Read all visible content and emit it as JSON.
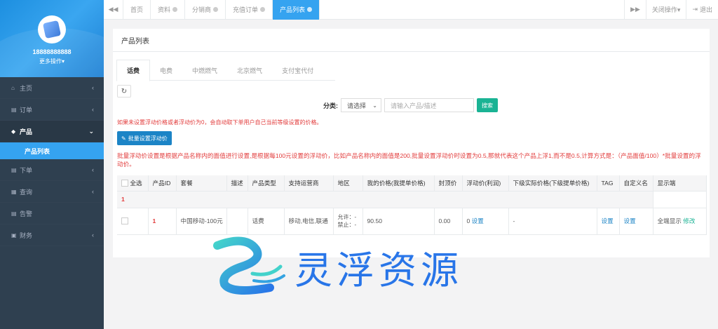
{
  "sidebar": {
    "phone": "18888888888",
    "more": "更多操作▾",
    "items": [
      {
        "label": "主页",
        "icon": "home-icon",
        "glyph": "⌂"
      },
      {
        "label": "订单",
        "icon": "file-icon",
        "glyph": "▤"
      },
      {
        "label": "产品",
        "icon": "cube-icon",
        "glyph": "◆"
      },
      {
        "label": "下单",
        "icon": "file-icon",
        "glyph": "▤"
      },
      {
        "label": "查询",
        "icon": "table-icon",
        "glyph": "▦"
      },
      {
        "label": "告警",
        "icon": "file-icon",
        "glyph": "▤"
      },
      {
        "label": "财务",
        "icon": "money-icon",
        "glyph": "▣"
      }
    ],
    "subitem": "产品列表"
  },
  "topbar": {
    "tabs": [
      "首页",
      "资料",
      "分销商",
      "充值订单",
      "产品列表"
    ],
    "close_ops": "关闭操作▾",
    "logout": "退出"
  },
  "panel": {
    "title": "产品列表",
    "subtabs": [
      "话费",
      "电费",
      "中燃燃气",
      "北京燃气",
      "支付宝代付"
    ],
    "filter_label": "分类:",
    "select_value": "请选择",
    "search_placeholder": "请输入产品/描述",
    "search_btn": "搜索",
    "warn1": "如果未设置浮动价格或者浮动价为0，会自动取下单用户自己当前等级设置的价格。",
    "batch_btn": "批量设置浮动价",
    "warn2": "批量浮动价设置是根据产品名称内的面值进行设置,是根据每100元设置的浮动价，比如产品名称内的面值是200,批量设置浮动价时设置为0.5,那就代表这个产品上浮1,而不是0.5,计算方式是：（产品面值/100）*批量设置的浮动价。"
  },
  "table": {
    "headers": [
      "全选",
      "产品ID",
      "套餐",
      "描述",
      "产品类型",
      "支持运营商",
      "地区",
      "我的价格(我提单价格)",
      "封顶价",
      "浮动价(利润)",
      "下级实际价格(下级提单价格)",
      "TAG",
      "自定义名",
      "显示端"
    ],
    "group": "1",
    "row": {
      "id": "1",
      "package": "中国移动-100元",
      "desc": "",
      "type": "话费",
      "carriers": "移动,电信,联通",
      "region_allow": "允许：-",
      "region_deny": "禁止：-",
      "my_price": "90.50",
      "cap": "0.00",
      "float_value": "0",
      "float_link": "设置",
      "sub_price": "-",
      "tag_link": "设置",
      "custom_link": "设置",
      "display": "全端显示",
      "display_edit": "修改"
    }
  },
  "watermark": {
    "text": "灵浮资源"
  },
  "colors": {
    "sidebar_bg": "#2f4050",
    "accent_blue": "#35a3f0",
    "search_green": "#1ab394",
    "warning_red": "#e23c3c"
  }
}
